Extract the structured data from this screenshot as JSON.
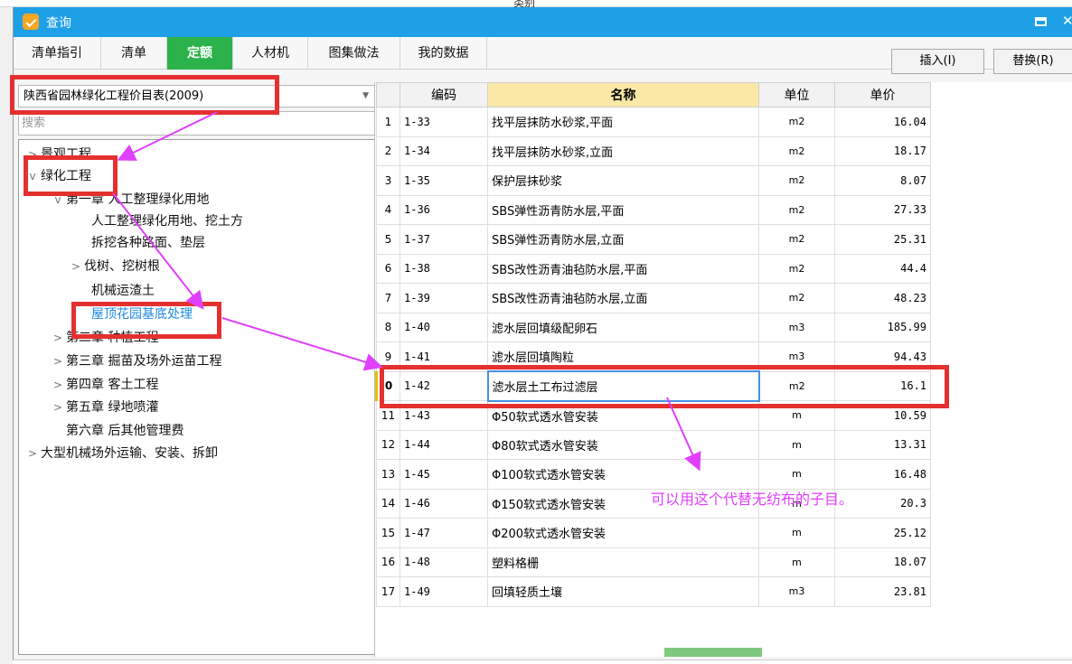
{
  "background": {
    "column_header": "类别"
  },
  "window": {
    "title": "查询",
    "maximize_icon": "maximize-icon",
    "close_icon": "close-icon",
    "accent": "#1ea0e6"
  },
  "tabs": [
    {
      "label": "清单指引"
    },
    {
      "label": "清单"
    },
    {
      "label": "定额",
      "active": true
    },
    {
      "label": "人材机"
    },
    {
      "label": "图集做法"
    },
    {
      "label": "我的数据"
    }
  ],
  "buttons": {
    "insert": "插入(I)",
    "replace": "替换(R)"
  },
  "library": {
    "selected": "陕西省园林绿化工程价目表(2009)",
    "search_placeholder": "搜索"
  },
  "tree": [
    {
      "label": "景观工程",
      "toggle": ">"
    },
    {
      "label": "绿化工程",
      "toggle": "v"
    },
    {
      "label": "第一章 人工整理绿化用地",
      "toggle": "v"
    },
    {
      "label": "人工整理绿化用地、挖土方",
      "toggle": ""
    },
    {
      "label": "拆挖各种路面、垫层",
      "toggle": ""
    },
    {
      "label": "伐树、挖树根",
      "toggle": ">"
    },
    {
      "label": "机械运渣土",
      "toggle": ""
    },
    {
      "label": "屋顶花园基底处理",
      "toggle": "",
      "selected": true
    },
    {
      "label": "第二章 种植工程",
      "toggle": ">"
    },
    {
      "label": "第三章 掘苗及场外运苗工程",
      "toggle": ">"
    },
    {
      "label": "第四章 客土工程",
      "toggle": ">"
    },
    {
      "label": "第五章 绿地喷灌",
      "toggle": ">"
    },
    {
      "label": "第六章 后其他管理费",
      "toggle": ""
    },
    {
      "label": "大型机械场外运输、安装、拆卸",
      "toggle": ">"
    }
  ],
  "grid": {
    "headers": {
      "code": "编码",
      "name": "名称",
      "unit": "单位",
      "price": "单价"
    },
    "rows": [
      {
        "idx": "1",
        "code": "1-33",
        "name": "找平层抹防水砂浆,平面",
        "unit": "m2",
        "price": "16.04"
      },
      {
        "idx": "2",
        "code": "1-34",
        "name": "找平层抹防水砂浆,立面",
        "unit": "m2",
        "price": "18.17"
      },
      {
        "idx": "3",
        "code": "1-35",
        "name": "保护层抹砂浆",
        "unit": "m2",
        "price": "8.07"
      },
      {
        "idx": "4",
        "code": "1-36",
        "name": "SBS弹性沥青防水层,平面",
        "unit": "m2",
        "price": "27.33"
      },
      {
        "idx": "5",
        "code": "1-37",
        "name": "SBS弹性沥青防水层,立面",
        "unit": "m2",
        "price": "25.31"
      },
      {
        "idx": "6",
        "code": "1-38",
        "name": "SBS改性沥青油毡防水层,平面",
        "unit": "m2",
        "price": "44.4"
      },
      {
        "idx": "7",
        "code": "1-39",
        "name": "SBS改性沥青油毡防水层,立面",
        "unit": "m2",
        "price": "48.23"
      },
      {
        "idx": "8",
        "code": "1-40",
        "name": "滤水层回填级配卵石",
        "unit": "m3",
        "price": "185.99"
      },
      {
        "idx": "9",
        "code": "1-41",
        "name": "滤水层回填陶粒",
        "unit": "m3",
        "price": "94.43"
      },
      {
        "idx": "0",
        "code": "1-42",
        "name": "滤水层土工布过滤层",
        "unit": "m2",
        "price": "16.1",
        "current": true
      },
      {
        "idx": "11",
        "code": "1-43",
        "name": "Φ50软式透水管安装",
        "unit": "m",
        "price": "10.59"
      },
      {
        "idx": "12",
        "code": "1-44",
        "name": "Φ80软式透水管安装",
        "unit": "m",
        "price": "13.31"
      },
      {
        "idx": "13",
        "code": "1-45",
        "name": "Φ100软式透水管安装",
        "unit": "m",
        "price": "16.48"
      },
      {
        "idx": "14",
        "code": "1-46",
        "name": "Φ150软式透水管安装",
        "unit": "m",
        "price": "20.3"
      },
      {
        "idx": "15",
        "code": "1-47",
        "name": "Φ200软式透水管安装",
        "unit": "m",
        "price": "25.12"
      },
      {
        "idx": "16",
        "code": "1-48",
        "name": "塑料格栅",
        "unit": "m",
        "price": "18.07"
      },
      {
        "idx": "17",
        "code": "1-49",
        "name": "回填轻质土壤",
        "unit": "m3",
        "price": "23.81"
      }
    ]
  },
  "annotation": {
    "text": "可以用这个代替无纺布的子目。",
    "color": "#e040fb",
    "highlight_color": "#e53030"
  }
}
